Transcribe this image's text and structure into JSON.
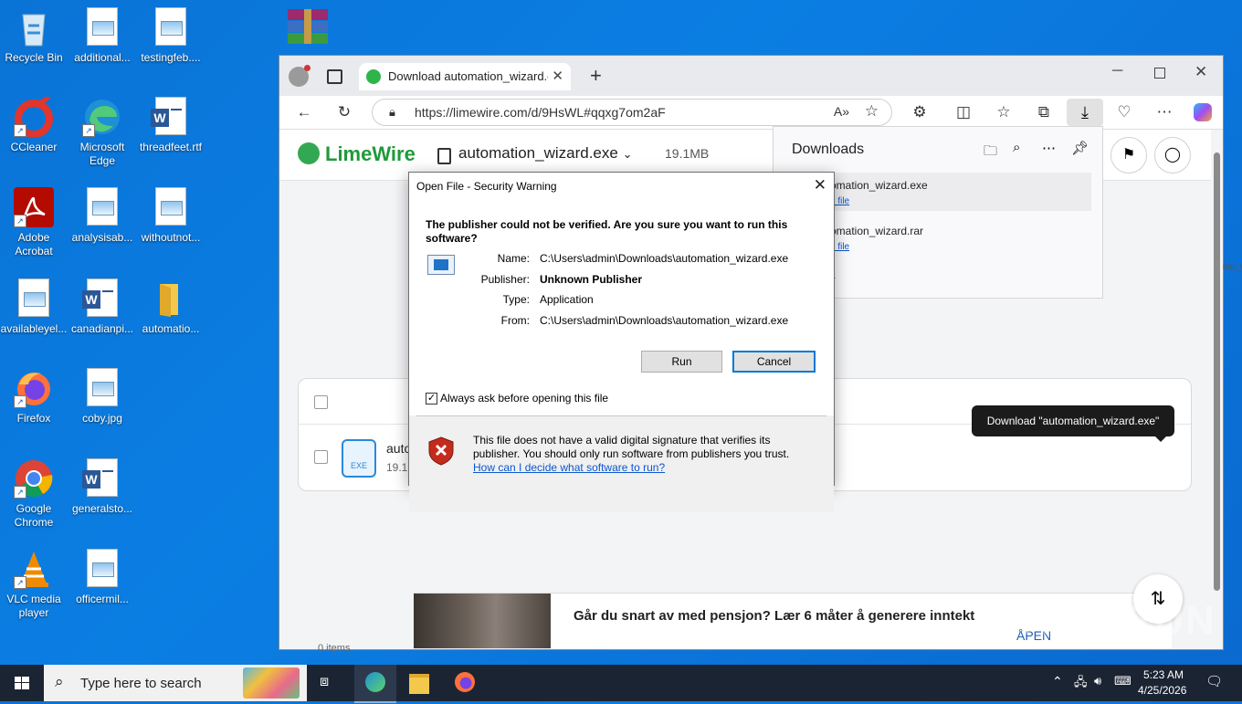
{
  "desktop": {
    "icons": [
      {
        "label": "Recycle Bin"
      },
      {
        "label": "additional..."
      },
      {
        "label": "testingfeb...."
      },
      {
        "label": "CCleaner"
      },
      {
        "label": "Microsoft Edge"
      },
      {
        "label": "threadfeet.rtf"
      },
      {
        "label": "Adobe Acrobat"
      },
      {
        "label": "analysisab..."
      },
      {
        "label": "withoutnot..."
      },
      {
        "label": "availableyel..."
      },
      {
        "label": "canadianpi..."
      },
      {
        "label": "automatio..."
      },
      {
        "label": "Firefox"
      },
      {
        "label": "coby.jpg"
      },
      {
        "label": "Google Chrome"
      },
      {
        "label": "generalsto..."
      },
      {
        "label": "VLC media player"
      },
      {
        "label": "officermil..."
      }
    ]
  },
  "browser": {
    "tab_title": "Download automation_wizard.exe",
    "url": "https://limewire.com/d/9HsWL#qqxg7om2aF"
  },
  "limewire": {
    "logo": "LimeWire",
    "filename": "automation_wizard.exe",
    "size": "19.1MB",
    "row_name": "auto",
    "row_size": "19.1M"
  },
  "downloads_panel": {
    "title": "Downloads",
    "items": [
      {
        "name": "omation_wizard.exe",
        "link": "n file"
      },
      {
        "name": "omation_wizard.rar",
        "link": "n file"
      }
    ],
    "more": "e"
  },
  "tooltip": "Download \"automation_wizard.exe\"",
  "dialog": {
    "title": "Open File - Security Warning",
    "question": "The publisher could not be verified.  Are you sure you want to run this software?",
    "fields": {
      "name_label": "Name:",
      "name_value": "C:\\Users\\admin\\Downloads\\automation_wizard.exe",
      "publisher_label": "Publisher:",
      "publisher_value": "Unknown Publisher",
      "type_label": "Type:",
      "type_value": "Application",
      "from_label": "From:",
      "from_value": "C:\\Users\\admin\\Downloads\\automation_wizard.exe"
    },
    "run": "Run",
    "cancel": "Cancel",
    "always_ask": "Always ask before opening this file",
    "warning": "This file does not have a valid digital signature that verifies its publisher.  You should only run software from publishers you trust.",
    "help_link": "How can I decide what software to run?"
  },
  "ad": {
    "text": "Går du snart av med pensjon? Lær 6 måter å generere inntekt",
    "cta": "ÅPEN"
  },
  "partial_texts": {
    "right_edge": "ion_v",
    "bottom_left": "0 items"
  },
  "taskbar": {
    "search_placeholder": "Type here to search",
    "time": "5:23 AM",
    "date": "4/25/2026"
  },
  "watermark": "ANY RUN"
}
